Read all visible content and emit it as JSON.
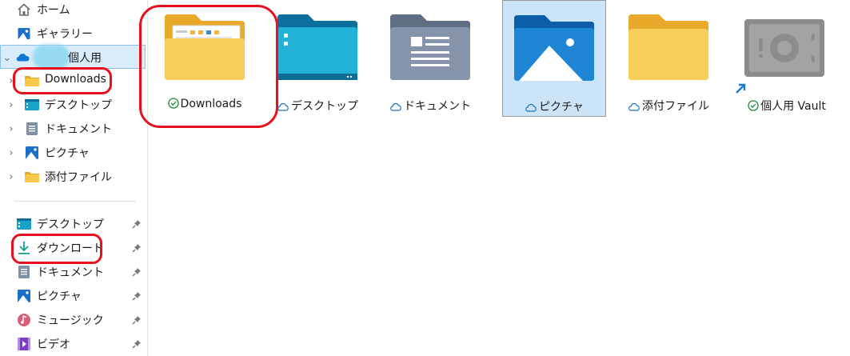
{
  "sidebar": {
    "items": [
      {
        "label": "ホーム",
        "icon": "home-icon"
      },
      {
        "label": "ギャラリー",
        "icon": "gallery-icon"
      },
      {
        "label": "個人用",
        "icon": "onedrive-cloud-icon"
      },
      {
        "label": "Downloads",
        "icon": "folder-icon"
      },
      {
        "label": "デスクトップ",
        "icon": "desktop-icon"
      },
      {
        "label": "ドキュメント",
        "icon": "documents-icon"
      },
      {
        "label": "ピクチャ",
        "icon": "pictures-icon"
      },
      {
        "label": "添付ファイル",
        "icon": "folder-icon"
      }
    ],
    "quick_access": [
      {
        "label": "デスクトップ",
        "icon": "desktop-icon"
      },
      {
        "label": "ダウンロード",
        "icon": "download-icon"
      },
      {
        "label": "ドキュメント",
        "icon": "documents-icon"
      },
      {
        "label": "ピクチャ",
        "icon": "pictures-icon"
      },
      {
        "label": "ミュージック",
        "icon": "music-icon"
      },
      {
        "label": "ビデオ",
        "icon": "video-icon"
      }
    ]
  },
  "main": {
    "items": [
      {
        "label": "Downloads",
        "status": "synced",
        "icon": "downloads-folder-icon"
      },
      {
        "label": "デスクトップ",
        "status": "cloud",
        "icon": "desktop-folder-icon"
      },
      {
        "label": "ドキュメント",
        "status": "cloud",
        "icon": "documents-folder-icon"
      },
      {
        "label": "ピクチャ",
        "status": "cloud",
        "icon": "pictures-folder-icon"
      },
      {
        "label": "添付ファイル",
        "status": "cloud",
        "icon": "folder-icon"
      },
      {
        "label": "個人用 Vault",
        "status": "synced",
        "icon": "vault-icon"
      }
    ]
  },
  "colors": {
    "selection": "#cce4f7",
    "highlight_ring": "#e6101e",
    "folder_yellow": "#f8c84a",
    "onedrive_blue": "#0f78d4"
  }
}
